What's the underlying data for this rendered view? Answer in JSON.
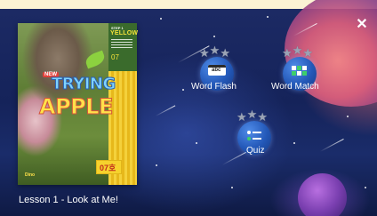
{
  "lesson": {
    "title": "Lesson 1 - Look at Me!"
  },
  "cover": {
    "series_small": "STEP 1",
    "level": "YELLOW",
    "volume": "07",
    "new_badge": "NEW",
    "title_line1": "TRYING",
    "title_line2": "APPLE",
    "issue_badge": "07호",
    "logo": "Dino"
  },
  "activities": [
    {
      "label": "Word Flash",
      "icon": "abc-card-icon",
      "stars": 3
    },
    {
      "label": "Word Match",
      "icon": "grid-match-icon",
      "stars": 3
    },
    {
      "label": "Quiz",
      "icon": "checklist-icon",
      "stars": 3
    }
  ],
  "controls": {
    "close_icon": "✕"
  },
  "colors": {
    "background": "#15235a",
    "accent_yellow": "#f4d13b",
    "planet_button": "#2358b8",
    "cream_strip": "#fbf3d4"
  }
}
